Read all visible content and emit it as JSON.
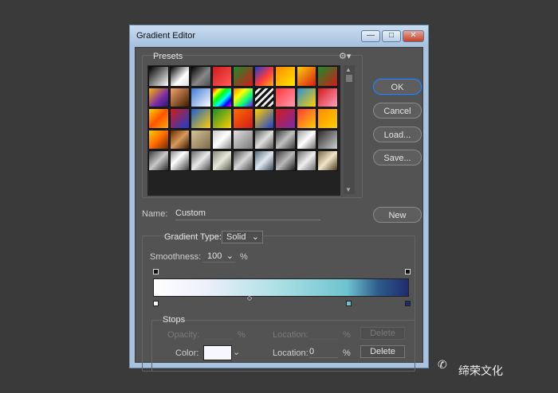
{
  "window": {
    "title": "Gradient Editor",
    "controls": [
      "—",
      "□",
      "✕"
    ]
  },
  "presets": {
    "label": "Presets",
    "gear": "⚙▾",
    "scroll_up": "▲",
    "scroll_down": "▼",
    "swatches": [
      "linear-gradient(135deg,#000 0%,#fff 100%)",
      "linear-gradient(135deg,#000 0%,#fff 60%,#ddd 100%)",
      "linear-gradient(135deg,#000 0%,#888 55%,rgba(255,255,255,0.2) 100%)",
      "linear-gradient(135deg,#d31b1b 0%,#ff5a5a 100%)",
      "linear-gradient(135deg,#1b8c2b 0%,#d31b1b 100%)",
      "linear-gradient(135deg,#1b3fd3 0%,#ff3b3b 55%,#ffb21b 100%)",
      "linear-gradient(135deg,#ff8a00 0%,#ffe600 100%)",
      "linear-gradient(135deg,#ffd000 0%,#d31b1b 100%)",
      "linear-gradient(135deg,#1b8c2b 0%,#d31b1b 100%)",
      "linear-gradient(135deg,#ffb400 0%,#7a2aa8 60%,#2a1a6e 100%)",
      "linear-gradient(135deg,#f5a36b 0%,#3e1a00 100%)",
      "linear-gradient(135deg,#3d7ad6 0%,#ffffff 100%)",
      "linear-gradient(135deg,#ff0000,#ffff00,#00ff00,#00ffff,#0000ff,#ff00ff)",
      "linear-gradient(135deg,#ff7f00,#ffff00,#00ff7f,#7f00ff)",
      "repeating-linear-gradient(135deg,#111 0 3px,#eee 3px 6px)",
      "linear-gradient(135deg,#ff3a3a 0%,#ff9ab0 100%)",
      "linear-gradient(135deg,#2a8fd6 0%,#ffd000 100%)",
      "linear-gradient(135deg,#d31b1b 0%,#ffa0c0 100%)",
      "linear-gradient(135deg,#ffd000 0%,#ff5500 50%,#ffaa00 100%)",
      "linear-gradient(135deg,#d31b1b 0%,#1b3fd3 100%)",
      "linear-gradient(135deg,#1b5fd3 0%,#ffd000 100%)",
      "linear-gradient(135deg,#1b8c2b 0%,#ffd000 100%)",
      "linear-gradient(135deg,#ff6a00 0%,#d31b1b 100%)",
      "linear-gradient(135deg,#ffd000 0%,#1b3fd3 100%)",
      "linear-gradient(135deg,#d31b1b 0%,#7a2aa8 100%)",
      "linear-gradient(135deg,#ff3a3a 0%,#ffd000 100%)",
      "linear-gradient(135deg,#ff8a00 0%,#ffd000 100%)",
      "linear-gradient(135deg,#ffd000 0%,#ff6a00 50%,#6e2a00 100%)",
      "linear-gradient(135deg,#6e2a00 0%,#d69a5a 50%,#3e1a00 100%)",
      "linear-gradient(135deg,#d6c59a 0%,#7a6a4a 100%)",
      "linear-gradient(135deg,#c8c8c8 0%,#ffffff 50%,#8a8a8a 100%)",
      "linear-gradient(135deg,#e0e0e0 0%,#7a7a7a 100%)",
      "linear-gradient(135deg,#5a5a5a 0%,#e0e0e0 50%,#5a5a5a 100%)",
      "linear-gradient(135deg,#3a3a3a 0%,#c0c0c0 50%,#3a3a3a 100%)",
      "linear-gradient(135deg,#9a9a9a 0%,#ffffff 50%,#6a6a6a 100%)",
      "linear-gradient(135deg,#2a2a2a 0%,#d0d0d0 100%)",
      "linear-gradient(135deg,#3a3a3a 0%,#c8c8c8 50%,#2a2a2a 100%)",
      "linear-gradient(135deg,#8a8a8a 0%,#ffffff 40%,#3a3a3a 100%)",
      "linear-gradient(135deg,#6a6a6a 0%,#e8e8e8 50%,#4a4a4a 100%)",
      "linear-gradient(135deg,#8a8a7a 0%,#e8e8d8 50%,#5a5a4a 100%)",
      "linear-gradient(135deg,#4a4a4a 0%,#d8d8d8 50%,#4a4a4a 100%)",
      "linear-gradient(135deg,#5a6a7a 0%,#dfe8f0 50%,#3a4a5a 100%)",
      "linear-gradient(135deg,#3a3a3a 0%,#bababa 50%,#1a1a1a 100%)",
      "linear-gradient(135deg,#6a6a6a 0%,#f0f0f0 50%,#6a6a6a 100%)",
      "linear-gradient(135deg,#7a6a4a 0%,#f0e6c8 50%,#4a3a1a 100%)"
    ]
  },
  "buttons": {
    "ok": "OK",
    "cancel": "Cancel",
    "load": "Load...",
    "save": "Save...",
    "new": "New"
  },
  "name": {
    "label": "Name:",
    "value": "Custom"
  },
  "gradient": {
    "type_label": "Gradient Type:",
    "type_value": "Solid",
    "smoothness_label": "Smoothness:",
    "smoothness_value": "100",
    "smoothness_unit": "%",
    "stop_colors": [
      "#ffffff",
      "#6ec3cf",
      "#1f2b6e"
    ]
  },
  "stops": {
    "label": "Stops",
    "opacity_label": "Opacity:",
    "opacity_value": "",
    "opacity_unit": "%",
    "opacity_location_label": "Location:",
    "opacity_location_value": "",
    "opacity_location_unit": "%",
    "delete_label": "Delete",
    "color_label": "Color:",
    "color_value": "#f7f7ff",
    "color_location_label": "Location:",
    "color_location_value": "0",
    "color_location_unit": "%",
    "color_delete_label": "Delete"
  },
  "watermark": {
    "text": "缔荣文化",
    "icon": "wechat-icon"
  }
}
